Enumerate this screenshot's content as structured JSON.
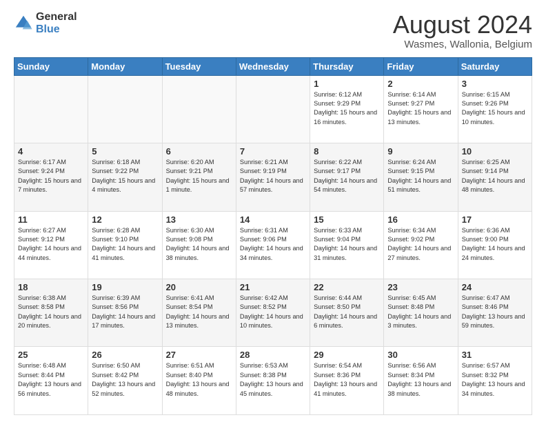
{
  "logo": {
    "general": "General",
    "blue": "Blue"
  },
  "title": "August 2024",
  "subtitle": "Wasmes, Wallonia, Belgium",
  "days_of_week": [
    "Sunday",
    "Monday",
    "Tuesday",
    "Wednesday",
    "Thursday",
    "Friday",
    "Saturday"
  ],
  "weeks": [
    [
      {
        "day": "",
        "info": ""
      },
      {
        "day": "",
        "info": ""
      },
      {
        "day": "",
        "info": ""
      },
      {
        "day": "",
        "info": ""
      },
      {
        "day": "1",
        "info": "Sunrise: 6:12 AM\nSunset: 9:29 PM\nDaylight: 15 hours and 16 minutes."
      },
      {
        "day": "2",
        "info": "Sunrise: 6:14 AM\nSunset: 9:27 PM\nDaylight: 15 hours and 13 minutes."
      },
      {
        "day": "3",
        "info": "Sunrise: 6:15 AM\nSunset: 9:26 PM\nDaylight: 15 hours and 10 minutes."
      }
    ],
    [
      {
        "day": "4",
        "info": "Sunrise: 6:17 AM\nSunset: 9:24 PM\nDaylight: 15 hours and 7 minutes."
      },
      {
        "day": "5",
        "info": "Sunrise: 6:18 AM\nSunset: 9:22 PM\nDaylight: 15 hours and 4 minutes."
      },
      {
        "day": "6",
        "info": "Sunrise: 6:20 AM\nSunset: 9:21 PM\nDaylight: 15 hours and 1 minute."
      },
      {
        "day": "7",
        "info": "Sunrise: 6:21 AM\nSunset: 9:19 PM\nDaylight: 14 hours and 57 minutes."
      },
      {
        "day": "8",
        "info": "Sunrise: 6:22 AM\nSunset: 9:17 PM\nDaylight: 14 hours and 54 minutes."
      },
      {
        "day": "9",
        "info": "Sunrise: 6:24 AM\nSunset: 9:15 PM\nDaylight: 14 hours and 51 minutes."
      },
      {
        "day": "10",
        "info": "Sunrise: 6:25 AM\nSunset: 9:14 PM\nDaylight: 14 hours and 48 minutes."
      }
    ],
    [
      {
        "day": "11",
        "info": "Sunrise: 6:27 AM\nSunset: 9:12 PM\nDaylight: 14 hours and 44 minutes."
      },
      {
        "day": "12",
        "info": "Sunrise: 6:28 AM\nSunset: 9:10 PM\nDaylight: 14 hours and 41 minutes."
      },
      {
        "day": "13",
        "info": "Sunrise: 6:30 AM\nSunset: 9:08 PM\nDaylight: 14 hours and 38 minutes."
      },
      {
        "day": "14",
        "info": "Sunrise: 6:31 AM\nSunset: 9:06 PM\nDaylight: 14 hours and 34 minutes."
      },
      {
        "day": "15",
        "info": "Sunrise: 6:33 AM\nSunset: 9:04 PM\nDaylight: 14 hours and 31 minutes."
      },
      {
        "day": "16",
        "info": "Sunrise: 6:34 AM\nSunset: 9:02 PM\nDaylight: 14 hours and 27 minutes."
      },
      {
        "day": "17",
        "info": "Sunrise: 6:36 AM\nSunset: 9:00 PM\nDaylight: 14 hours and 24 minutes."
      }
    ],
    [
      {
        "day": "18",
        "info": "Sunrise: 6:38 AM\nSunset: 8:58 PM\nDaylight: 14 hours and 20 minutes."
      },
      {
        "day": "19",
        "info": "Sunrise: 6:39 AM\nSunset: 8:56 PM\nDaylight: 14 hours and 17 minutes."
      },
      {
        "day": "20",
        "info": "Sunrise: 6:41 AM\nSunset: 8:54 PM\nDaylight: 14 hours and 13 minutes."
      },
      {
        "day": "21",
        "info": "Sunrise: 6:42 AM\nSunset: 8:52 PM\nDaylight: 14 hours and 10 minutes."
      },
      {
        "day": "22",
        "info": "Sunrise: 6:44 AM\nSunset: 8:50 PM\nDaylight: 14 hours and 6 minutes."
      },
      {
        "day": "23",
        "info": "Sunrise: 6:45 AM\nSunset: 8:48 PM\nDaylight: 14 hours and 3 minutes."
      },
      {
        "day": "24",
        "info": "Sunrise: 6:47 AM\nSunset: 8:46 PM\nDaylight: 13 hours and 59 minutes."
      }
    ],
    [
      {
        "day": "25",
        "info": "Sunrise: 6:48 AM\nSunset: 8:44 PM\nDaylight: 13 hours and 56 minutes."
      },
      {
        "day": "26",
        "info": "Sunrise: 6:50 AM\nSunset: 8:42 PM\nDaylight: 13 hours and 52 minutes."
      },
      {
        "day": "27",
        "info": "Sunrise: 6:51 AM\nSunset: 8:40 PM\nDaylight: 13 hours and 48 minutes."
      },
      {
        "day": "28",
        "info": "Sunrise: 6:53 AM\nSunset: 8:38 PM\nDaylight: 13 hours and 45 minutes."
      },
      {
        "day": "29",
        "info": "Sunrise: 6:54 AM\nSunset: 8:36 PM\nDaylight: 13 hours and 41 minutes."
      },
      {
        "day": "30",
        "info": "Sunrise: 6:56 AM\nSunset: 8:34 PM\nDaylight: 13 hours and 38 minutes."
      },
      {
        "day": "31",
        "info": "Sunrise: 6:57 AM\nSunset: 8:32 PM\nDaylight: 13 hours and 34 minutes."
      }
    ]
  ]
}
